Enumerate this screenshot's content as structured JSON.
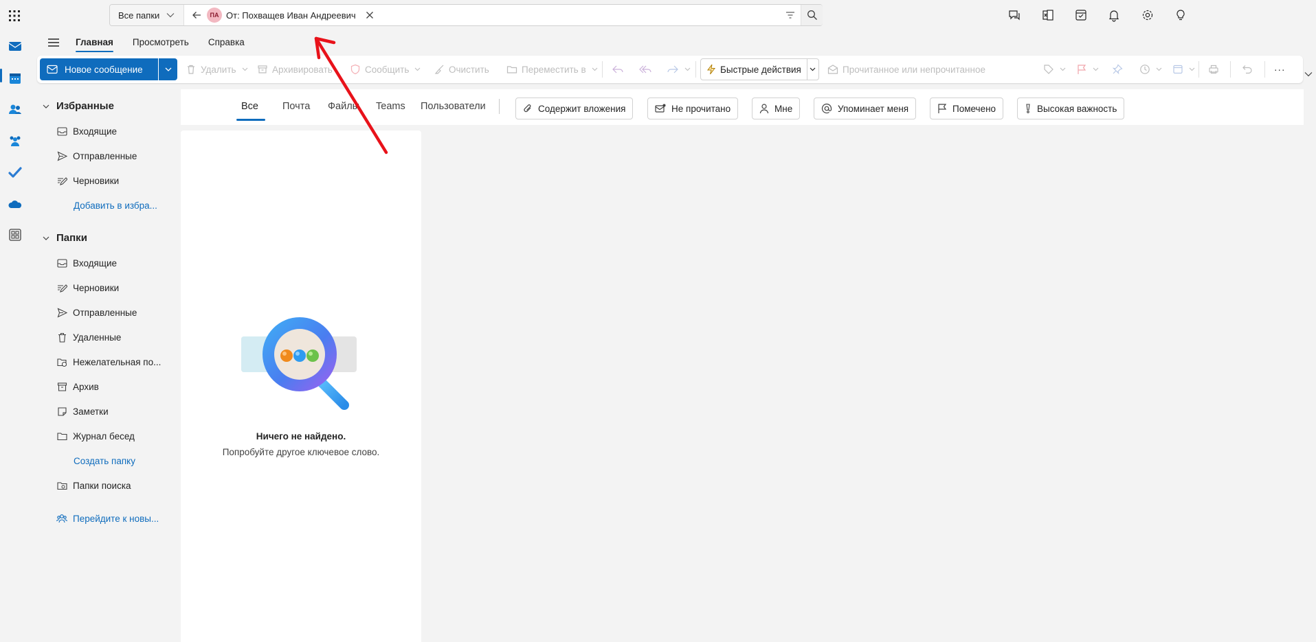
{
  "search": {
    "scope_label": "Все папки",
    "avatar_initials": "ПА",
    "query_pill": "От: Похващев Иван Андреевич"
  },
  "ribbon_tabs": [
    "Главная",
    "Просмотреть",
    "Справка"
  ],
  "ribbon": {
    "new_message": "Новое сообщение",
    "delete": "Удалить",
    "archive": "Архивировать",
    "report": "Сообщить",
    "sweep": "Очистить",
    "move": "Переместить в",
    "quick_actions": "Быстрые действия",
    "read_unread": "Прочитанное или непрочитанное",
    "more": "···"
  },
  "favorites": {
    "header": "Избранные",
    "items": [
      "Входящие",
      "Отправленные",
      "Черновики"
    ],
    "add_link": "Добавить в избра..."
  },
  "folders": {
    "header": "Папки",
    "items": [
      "Входящие",
      "Черновики",
      "Отправленные",
      "Удаленные",
      "Нежелательная по...",
      "Архив",
      "Заметки",
      "Журнал бесед"
    ],
    "create_link": "Создать папку",
    "search_folders": "Папки поиска",
    "groups_link": "Перейдите к новы..."
  },
  "filter_tabs": [
    "Все",
    "Почта",
    "Файлы",
    "Teams",
    "Пользователи"
  ],
  "filter_chips": [
    "Содержит вложения",
    "Не прочитано",
    "Мне",
    "Упоминает меня",
    "Помечено",
    "Высокая важность"
  ],
  "empty_state": {
    "title": "Ничего не найдено.",
    "subtitle": "Попробуйте другое ключевое слово."
  },
  "colors": {
    "accent": "#0f6cbd",
    "annotation_arrow": "#e8121a"
  }
}
